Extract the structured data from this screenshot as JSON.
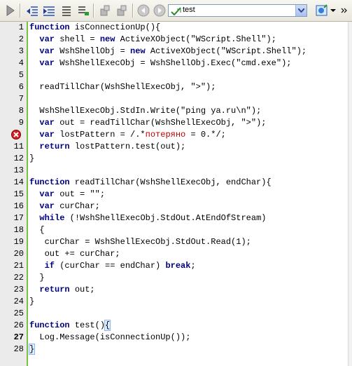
{
  "toolbar": {
    "combo_value": "test",
    "buttons": [
      "run-button",
      "shift-left-button",
      "shift-right-button",
      "comment-button",
      "uncomment-button",
      "toggle-bookmark-button",
      "next-bookmark-button",
      "back-button",
      "forward-button",
      "bookmarks-menu-button"
    ]
  },
  "gutter": {
    "line_numbers": [
      "1",
      "2",
      "3",
      "4",
      "5",
      "6",
      "7",
      "8",
      "9",
      "10",
      "11",
      "12",
      "13",
      "14",
      "15",
      "16",
      "17",
      "18",
      "19",
      "20",
      "21",
      "22",
      "23",
      "24",
      "25",
      "26",
      "27",
      "28"
    ],
    "error_line": 10
  },
  "code": {
    "lines": [
      "function isConnectionUp(){",
      "  var shell = new ActiveXObject(\"WScript.Shell\");",
      "  var WshShellObj = new ActiveXObject(\"WScript.Shell\");",
      "  var WshShellExecObj = WshShellObj.Exec(\"cmd.exe\");",
      "",
      "  readTillChar(WshShellExecObj, \">\");",
      "",
      "  WshShellExecObj.StdIn.Write(\"ping ya.ru\\n\");",
      "  var out = readTillChar(WshShellExecObj, \">\");",
      "  var lostPattern = /.*потеряно = 0.*/;",
      "  return lostPattern.test(out);",
      "}",
      "",
      "function readTillChar(WshShellExecObj, endChar){",
      "  var out = \"\";",
      "  var curChar;",
      "  while (!WshShellExecObj.StdOut.AtEndOfStream)",
      "  {",
      "   curChar = WshShellExecObj.StdOut.Read(1);",
      "   out += curChar;",
      "   if (curChar == endChar) break;",
      "  }",
      "  return out;",
      "}",
      "",
      "function test(){",
      "  Log.Message(isConnectionUp());",
      "}"
    ]
  }
}
